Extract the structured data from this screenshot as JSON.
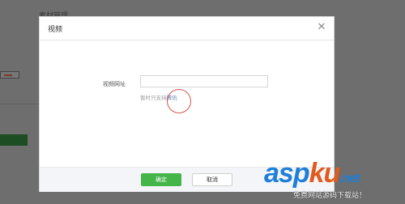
{
  "background": {
    "section_title": "素材管理"
  },
  "dialog": {
    "title": "视频",
    "close_symbol": "✕",
    "url_label": "视频网址",
    "url_value": "",
    "hint_prefix": "暂时只支持",
    "hint_link": "腾讯",
    "ok_label": "确定",
    "cancel_label": "取消"
  },
  "watermark": {
    "brand_part1": "asp",
    "brand_part2": "ku",
    "brand_suffix": ".net",
    "tagline": "免费网站源码下载站！"
  },
  "colors": {
    "ok_button": "#44b549",
    "annotation_circle": "#d9544f",
    "watermark_blue": "#1e7fd6",
    "watermark_orange": "#e25a1c"
  }
}
